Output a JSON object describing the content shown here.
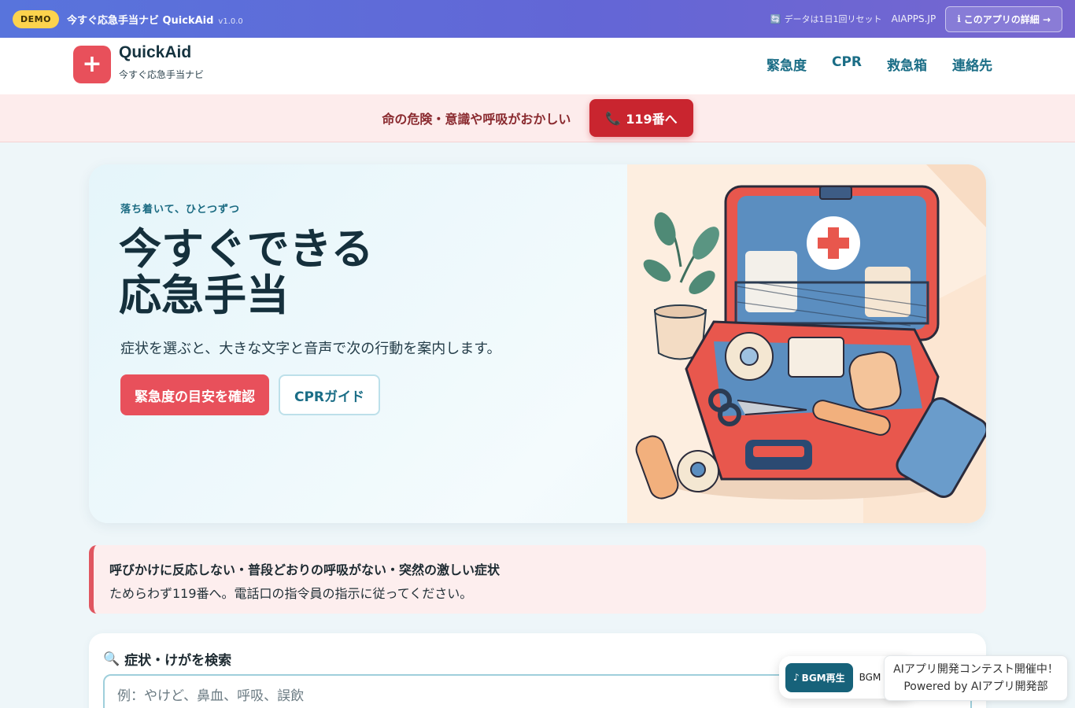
{
  "demo_bar": {
    "badge": "DEMO",
    "title": "今すぐ応急手当ナビ QuickAid",
    "version": "v1.0.0",
    "reset_icon": "🔄",
    "reset_note": "データは1日1回リセット",
    "site": "AIAPPS.JP",
    "detail_icon": "ℹ",
    "detail_button": "このアプリの詳細 →"
  },
  "header": {
    "logo_icon": "+",
    "brand_name": "QuickAid",
    "brand_sub": "今すぐ応急手当ナビ",
    "nav": [
      "緊急度",
      "CPR",
      "救急箱",
      "連絡先"
    ]
  },
  "emergency_strip": {
    "text": "命の危険・意識や呼吸がおかしい",
    "call_icon": "📞",
    "call_button": "119番へ"
  },
  "hero": {
    "eyebrow": "落ち着いて、ひとつずつ",
    "title_line1": "今すぐできる",
    "title_line2": "応急手当",
    "description": "症状を選ぶと、大きな文字と音声で次の行動を案内します。",
    "primary_button": "緊急度の目安を確認",
    "secondary_button": "CPRガイド"
  },
  "warning": {
    "title": "呼びかけに反応しない・普段どおりの呼吸がない・突然の激しい症状",
    "body": "ためらわず119番へ。電話口の指令員の指示に従ってください。"
  },
  "search": {
    "icon": "🔍",
    "label": "症状・けがを検索",
    "placeholder": "例：やけど、鼻血、呼吸、誤飲"
  },
  "bgm": {
    "button_icon": "♪",
    "button": "BGM再生",
    "label": "BGM"
  },
  "contest": {
    "line1": "AIアプリ開発コンテスト開催中！",
    "line2": "Powered by AIアプリ開発部"
  },
  "colors": {
    "accent_red": "#e8505b",
    "call_red": "#c9252f",
    "teal": "#1a6d86",
    "demo_bar": "#6366d6"
  }
}
